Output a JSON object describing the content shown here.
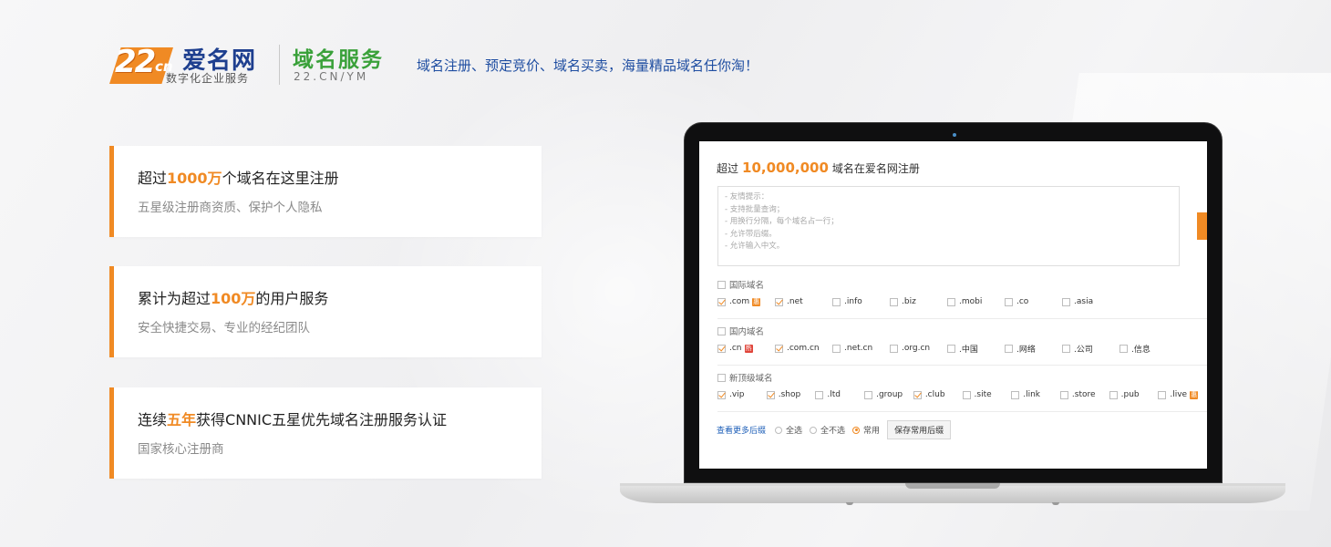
{
  "header": {
    "logo_number": "22",
    "logo_cn": "cn",
    "logo_name": "爱名网",
    "logo_sub": "数字化企业服务",
    "service_title": "域名服务",
    "service_url": "22.CN/YM",
    "slogan": "域名注册、预定竞价、域名买卖，海量精品域名任你淘！"
  },
  "features": [
    {
      "pre": "超过",
      "hl": "1000万",
      "post": "个域名在这里注册",
      "desc": "五星级注册商资质、保护个人隐私"
    },
    {
      "pre": "累计为超过",
      "hl": "100万",
      "post": "的用户服务",
      "desc": "安全快捷交易、专业的经纪团队"
    },
    {
      "pre": "连续",
      "hl": "五年",
      "post": "获得CNNIC五星优先域名注册服务认证",
      "desc": "国家核心注册商"
    }
  ],
  "screen": {
    "head_pre": "超过",
    "head_num": "10,000,000",
    "head_post": "域名在爱名网注册",
    "tips": [
      "- 友情提示：",
      "- 支持批量查询；",
      "- 用换行分隔，每个域名占一行；",
      "- 允许带后缀。",
      "- 允许输入中文。"
    ],
    "groups": [
      {
        "title": "国际域名",
        "items": [
          {
            "label": ".com",
            "checked": true,
            "badge": "惠",
            "badge_color": "#f08a24"
          },
          {
            "label": ".net",
            "checked": true
          },
          {
            "label": ".info",
            "checked": false
          },
          {
            "label": ".biz",
            "checked": false
          },
          {
            "label": ".mobi",
            "checked": false
          },
          {
            "label": ".co",
            "checked": false
          },
          {
            "label": ".asia",
            "checked": false
          }
        ]
      },
      {
        "title": "国内域名",
        "items": [
          {
            "label": ".cn",
            "checked": true,
            "badge": "热",
            "badge_color": "#e0453a"
          },
          {
            "label": ".com.cn",
            "checked": true
          },
          {
            "label": ".net.cn",
            "checked": false
          },
          {
            "label": ".org.cn",
            "checked": false
          },
          {
            "label": ".中国",
            "checked": false
          },
          {
            "label": ".网络",
            "checked": false
          },
          {
            "label": ".公司",
            "checked": false
          },
          {
            "label": ".信息",
            "checked": false
          }
        ]
      },
      {
        "title": "新顶级域名",
        "items": [
          {
            "label": ".vip",
            "checked": true
          },
          {
            "label": ".shop",
            "checked": true
          },
          {
            "label": ".ltd",
            "checked": false
          },
          {
            "label": ".group",
            "checked": false
          },
          {
            "label": ".club",
            "checked": true
          },
          {
            "label": ".site",
            "checked": false
          },
          {
            "label": ".link",
            "checked": false
          },
          {
            "label": ".store",
            "checked": false
          },
          {
            "label": ".pub",
            "checked": false
          },
          {
            "label": ".live",
            "checked": false,
            "badge": "惠",
            "badge_color": "#f08a24"
          }
        ]
      }
    ],
    "footer": {
      "more": "查看更多后缀",
      "options": [
        {
          "label": "全选",
          "selected": false
        },
        {
          "label": "全不选",
          "selected": false
        },
        {
          "label": "常用",
          "selected": true
        }
      ],
      "save": "保存常用后缀"
    }
  },
  "colors": {
    "accent": "#f08a24",
    "brand_blue": "#1e3f8f",
    "service_green": "#3aa13a",
    "link_blue": "#1e5fb8"
  }
}
